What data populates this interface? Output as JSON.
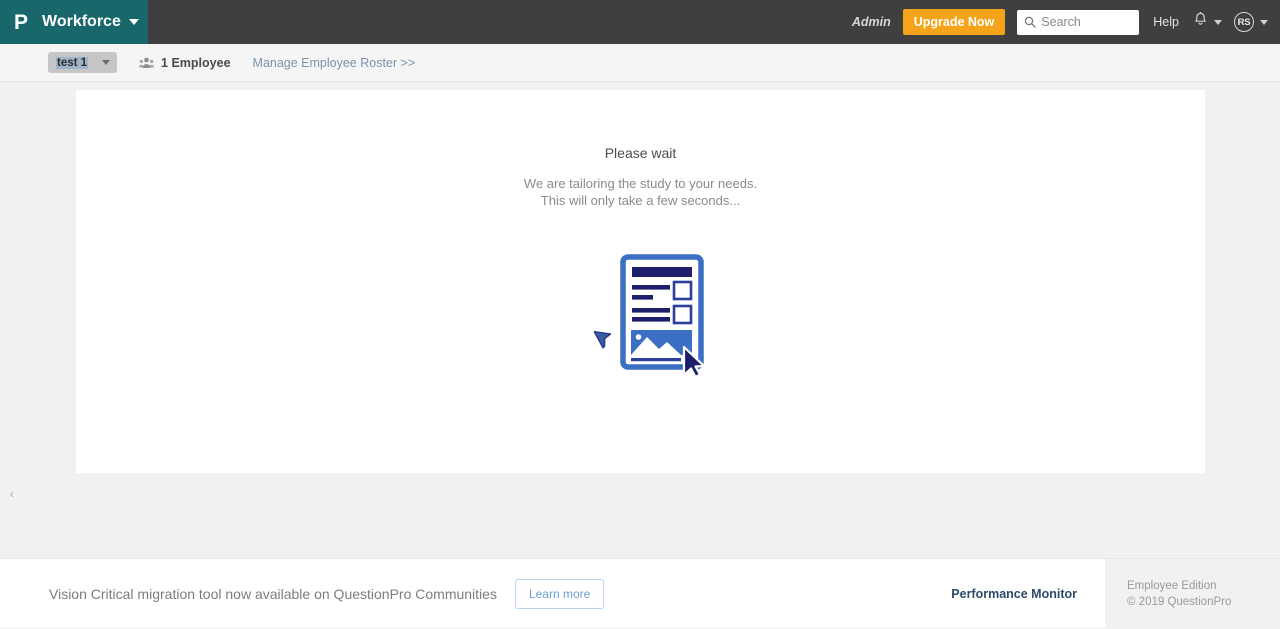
{
  "header": {
    "logo_glyph": "P",
    "brand_name": "Workforce",
    "brand_caret": "chevron-down-icon",
    "admin_label": "Admin",
    "upgrade_label": "Upgrade Now",
    "search_placeholder": "Search",
    "search_value": "",
    "help_label": "Help",
    "avatar_initials": "RS",
    "colors": {
      "brand_teal": "#17676b",
      "bar_grey": "#3f3f3f",
      "upgrade_orange": "#f5a31a"
    }
  },
  "subheader": {
    "project_name": "test 1",
    "employee_count": "1 Employee",
    "roster_link": "Manage Employee Roster >>"
  },
  "main": {
    "title": "Please wait",
    "subtitle_line1": "We are tailoring the study to your needs.",
    "subtitle_line2": "This will only take a few seconds...",
    "illustration_name": "survey-document-illustration"
  },
  "sidebar": {
    "collapse_glyph": "‹"
  },
  "footer": {
    "promo_text": "Vision Critical migration tool now available on QuestionPro Communities",
    "learn_more_label": "Learn more",
    "performance_monitor_label": "Performance Monitor",
    "edition_label": "Employee Edition",
    "copyright": "© 2019 QuestionPro"
  }
}
